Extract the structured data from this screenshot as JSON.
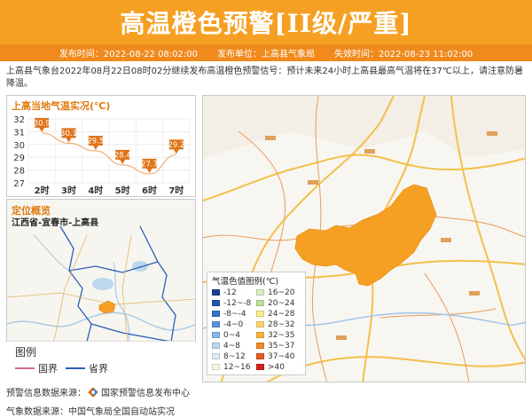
{
  "header": {
    "title": "高温橙色预警[II级/严重]",
    "publish_time": "发布时间：2022-08-22 08:02:00",
    "publisher": "发布单位：上高县气象局",
    "expire_time": "失效时间：2022-08-23 11:02:00"
  },
  "description": "上高县气象台2022年08月22日08时02分继续发布高温橙色预警信号：预计未来24小时上高县最高气温将在37℃以上，请注意防暑降温。",
  "temperature_panel": {
    "title": "上高当地气温实况(℃)",
    "y_ticks": [
      "32",
      "31",
      "30",
      "29",
      "28",
      "27"
    ]
  },
  "chart_data": {
    "type": "line",
    "title": "上高当地气温实况(℃)",
    "categories": [
      "2时",
      "3时",
      "4时",
      "5时",
      "6时",
      "7时"
    ],
    "values": [
      30.9,
      30.1,
      29.5,
      28.4,
      27.7,
      29.2
    ],
    "value_labels": [
      "30.9",
      "30.1",
      "29.5",
      "28.4",
      "27.7",
      "29.2"
    ],
    "ylim": [
      27,
      32
    ],
    "grid": true,
    "color": "#e0741a"
  },
  "location_panel": {
    "title": "定位概览",
    "location": "江西省-宜春市-上高县",
    "legend_title": "图例",
    "legend_items": [
      {
        "label": "国界",
        "color": "#d26b8a"
      },
      {
        "label": "省界",
        "color": "#2a5fb8"
      }
    ]
  },
  "map_legend": {
    "title": "气温色值图例(℃)",
    "items": [
      {
        "label": "-12",
        "color": "#1b3f8f"
      },
      {
        "label": "-12~-8",
        "color": "#2356a8"
      },
      {
        "label": "-8~-4",
        "color": "#3573c4"
      },
      {
        "label": "-4~0",
        "color": "#5695d8"
      },
      {
        "label": "0~4",
        "color": "#86b8e6"
      },
      {
        "label": "4~8",
        "color": "#b6d6f0"
      },
      {
        "label": "8~12",
        "color": "#dcebf7"
      },
      {
        "label": "12~16",
        "color": "#f2f8e6"
      },
      {
        "label": "16~20",
        "color": "#d7eec0"
      },
      {
        "label": "20~24",
        "color": "#bde19a"
      },
      {
        "label": "24~28",
        "color": "#fbee8a"
      },
      {
        "label": "28~32",
        "color": "#fbd36a"
      },
      {
        "label": "32~35",
        "color": "#f9b33f"
      },
      {
        "label": "35~37",
        "color": "#f08a2a"
      },
      {
        "label": "37~40",
        "color": "#e8581f"
      },
      {
        "label": ">40",
        "color": "#d41f1f"
      }
    ]
  },
  "sources": {
    "warning_label": "预警信息数据来源：",
    "warning_value": "国家预警信息发布中心",
    "weather_label": "气象数据来源：",
    "weather_value": "中国气象局全国自动站实况"
  }
}
